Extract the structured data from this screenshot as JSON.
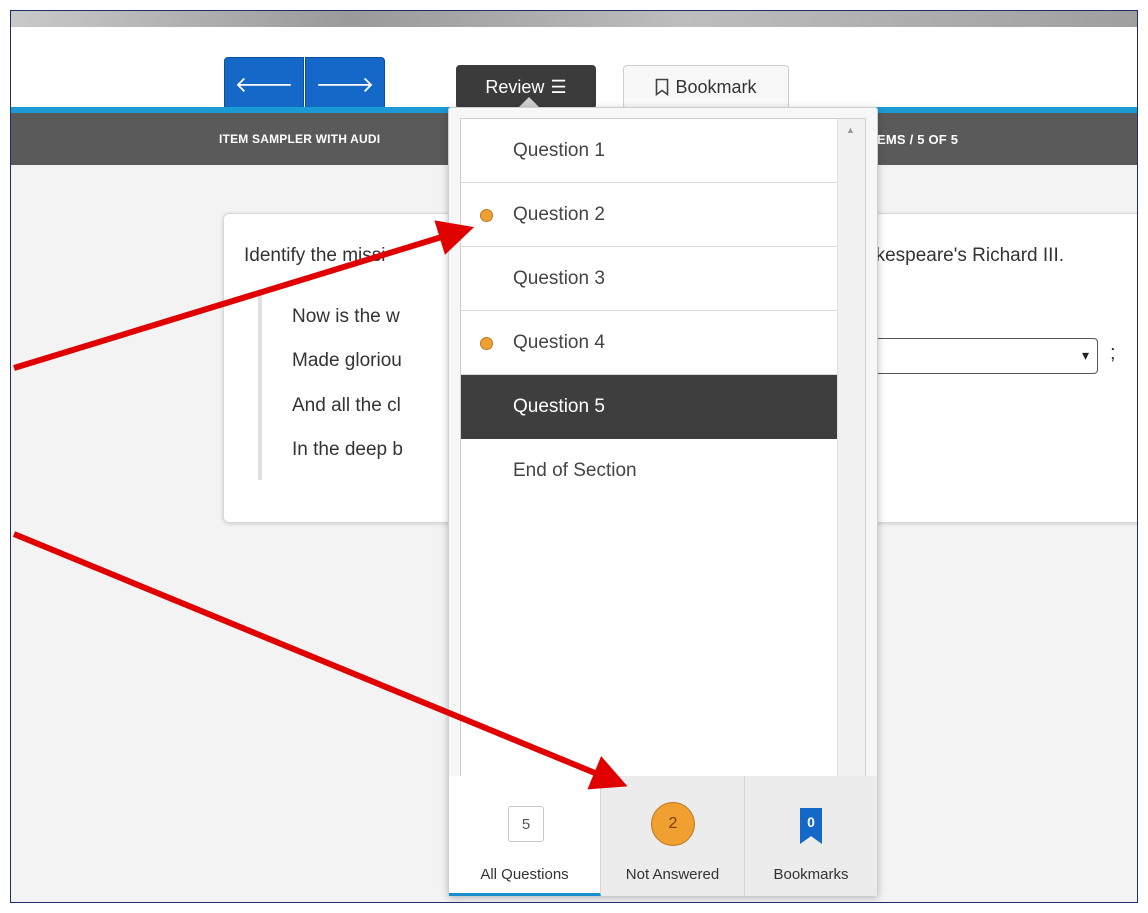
{
  "toolbar": {
    "prev_icon": "arrow-left-icon",
    "next_icon": "arrow-right-icon",
    "prev_glyph": "🡐",
    "next_glyph": "🡒",
    "review_label": "Review",
    "review_icon": "list-icon",
    "review_glyph": "☰",
    "bookmark_label": "Bookmark",
    "bookmark_icon": "bookmark-icon"
  },
  "header": {
    "left_text": "ITEM SAMPLER WITH AUDI",
    "right_text": "EMS  /  5 OF 5"
  },
  "question": {
    "prompt_visible_left": "Identify the missi",
    "prompt_visible_right": "akespeare's Richard III.",
    "poem_lines": [
      "Now is the w",
      "Made gloriou",
      "And all the cl",
      "In the deep b"
    ],
    "semicolon": ";",
    "dropdown_arrow": "▾"
  },
  "review_panel": {
    "items": [
      {
        "label": "Question 1",
        "not_answered": false,
        "selected": false
      },
      {
        "label": "Question 2",
        "not_answered": true,
        "selected": false
      },
      {
        "label": "Question 3",
        "not_answered": false,
        "selected": false
      },
      {
        "label": "Question 4",
        "not_answered": true,
        "selected": false
      },
      {
        "label": "Question 5",
        "not_answered": false,
        "selected": true
      },
      {
        "label": "End of Section",
        "not_answered": false,
        "selected": false
      }
    ],
    "tabs": {
      "all": {
        "label": "All Questions",
        "count": "5"
      },
      "not_answered": {
        "label": "Not Answered",
        "count": "2"
      },
      "bookmarks": {
        "label": "Bookmarks",
        "count": "0"
      }
    }
  },
  "colors": {
    "accent_blue": "#1468c8",
    "not_answered_orange": "#f0a030",
    "selected_dark": "#3e3e3e",
    "annotation_red": "#e00000"
  }
}
